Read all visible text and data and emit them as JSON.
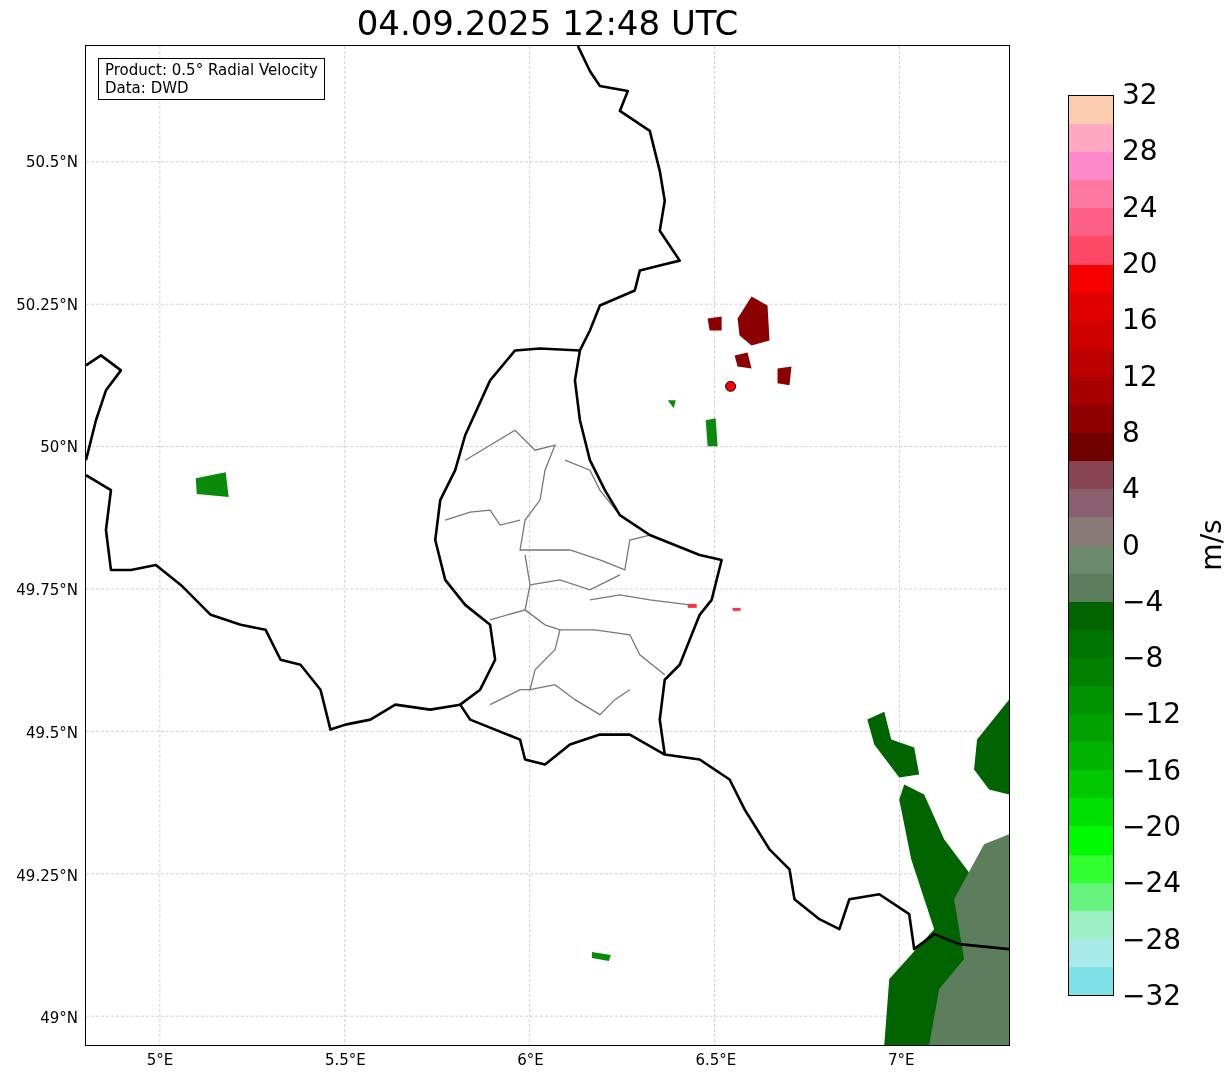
{
  "title": "04.09.2025 12:48 UTC",
  "info_box": {
    "lines": [
      "Product: 0.5° Radial Velocity",
      "Data: DWD"
    ]
  },
  "map": {
    "lat_labels": [
      "50.5°N",
      "50.25°N",
      "50°N",
      "49.75°N",
      "49.5°N",
      "49.25°N",
      "49°N"
    ],
    "lon_labels": [
      "5°E",
      "5.5°E",
      "6°E",
      "6.5°E",
      "7°E"
    ]
  },
  "colorbar": {
    "label": "m/s",
    "ticks": [
      "32",
      "28",
      "24",
      "20",
      "16",
      "12",
      "8",
      "4",
      "0",
      "−4",
      "−8",
      "−12",
      "−16",
      "−20",
      "−24",
      "−28",
      "−32"
    ],
    "bins": [
      {
        "color": "#fecdb0"
      },
      {
        "color": "#fea8c4"
      },
      {
        "color": "#fe88cc"
      },
      {
        "color": "#fe78a4"
      },
      {
        "color": "#fe6088"
      },
      {
        "color": "#fe4866"
      },
      {
        "color": "#f60000"
      },
      {
        "color": "#e00000"
      },
      {
        "color": "#d00000"
      },
      {
        "color": "#bc0000"
      },
      {
        "color": "#a80000"
      },
      {
        "color": "#900000"
      },
      {
        "color": "#700000"
      },
      {
        "color": "#884450"
      },
      {
        "color": "#8a6070"
      },
      {
        "color": "#8a7a78"
      },
      {
        "color": "#6c8a6c"
      },
      {
        "color": "#5c7e5c"
      },
      {
        "color": "#006400"
      },
      {
        "color": "#007400"
      },
      {
        "color": "#008200"
      },
      {
        "color": "#009200"
      },
      {
        "color": "#00a200"
      },
      {
        "color": "#00b400"
      },
      {
        "color": "#00c800"
      },
      {
        "color": "#00e000"
      },
      {
        "color": "#00fa00"
      },
      {
        "color": "#30ff30"
      },
      {
        "color": "#66f47e"
      },
      {
        "color": "#9cf0c4"
      },
      {
        "color": "#a8eaea"
      },
      {
        "color": "#7ee2e8"
      }
    ]
  }
}
